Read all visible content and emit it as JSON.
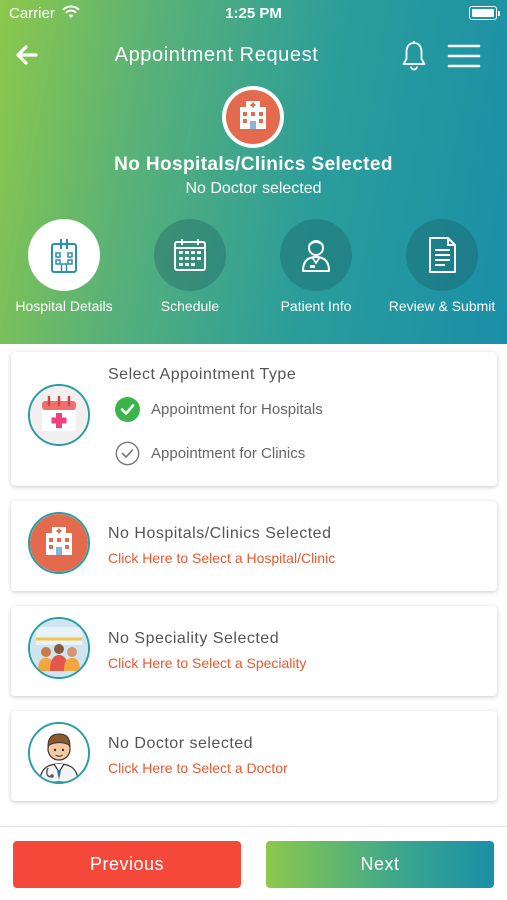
{
  "status_bar": {
    "carrier": "Carrier",
    "time": "1:25 PM"
  },
  "header": {
    "title": "Appointment Request",
    "selected_hospital": "No Hospitals/Clinics Selected",
    "selected_doctor": "No Doctor selected"
  },
  "steps": [
    {
      "label": "Hospital Details",
      "icon": "hospital-building-icon",
      "active": true
    },
    {
      "label": "Schedule",
      "icon": "calendar-icon",
      "active": false
    },
    {
      "label": "Patient Info",
      "icon": "patient-icon",
      "active": false
    },
    {
      "label": "Review & Submit",
      "icon": "document-icon",
      "active": false
    }
  ],
  "appointment_type": {
    "title": "Select Appointment Type",
    "options": [
      {
        "label": "Appointment for Hospitals",
        "selected": true
      },
      {
        "label": "Appointment for Clinics",
        "selected": false
      }
    ]
  },
  "hospital_card": {
    "title": "No Hospitals/Clinics Selected",
    "link": "Click Here to Select a Hospital/Clinic"
  },
  "speciality_card": {
    "title": "No Speciality Selected",
    "link": "Click Here to Select a Speciality"
  },
  "doctor_card": {
    "title": "No Doctor selected",
    "link": "Click Here to Select a Doctor"
  },
  "buttons": {
    "previous": "Previous",
    "next": "Next"
  },
  "colors": {
    "accent_teal": "#1a8fa8",
    "accent_green": "#8cc84b",
    "link_orange": "#e8582d",
    "previous_red": "#f4483b",
    "check_green": "#3bb54a"
  }
}
